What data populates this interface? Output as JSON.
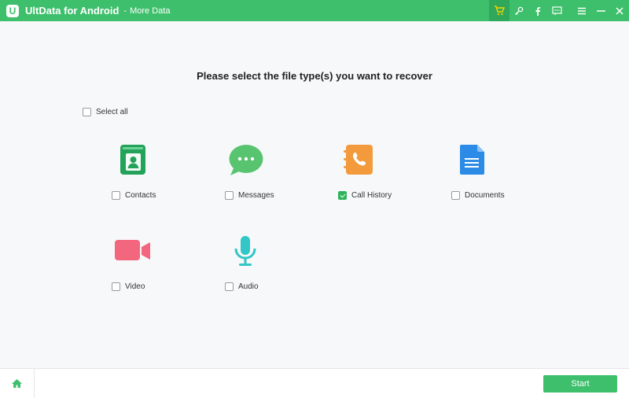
{
  "app": {
    "title": "UltData for Android",
    "separator": "-",
    "section": "More Data",
    "logo_letter": "U",
    "accent_color": "#3dbf6b"
  },
  "titlebar_icons": [
    "cart-icon",
    "key-icon",
    "facebook-icon",
    "feedback-icon",
    "menu-icon",
    "minimize-icon",
    "close-icon"
  ],
  "main": {
    "heading": "Please select the file type(s) you want to recover",
    "select_all_label": "Select all",
    "select_all_checked": false,
    "file_types": [
      {
        "label": "Contacts",
        "icon": "contacts-icon",
        "checked": false
      },
      {
        "label": "Messages",
        "icon": "messages-icon",
        "checked": false
      },
      {
        "label": "Call History",
        "icon": "call-history-icon",
        "checked": true
      },
      {
        "label": "Documents",
        "icon": "documents-icon",
        "checked": false
      },
      {
        "label": "Video",
        "icon": "video-icon",
        "checked": false
      },
      {
        "label": "Audio",
        "icon": "audio-icon",
        "checked": false
      }
    ]
  },
  "footer": {
    "home_icon": "home-icon",
    "start_label": "Start"
  }
}
